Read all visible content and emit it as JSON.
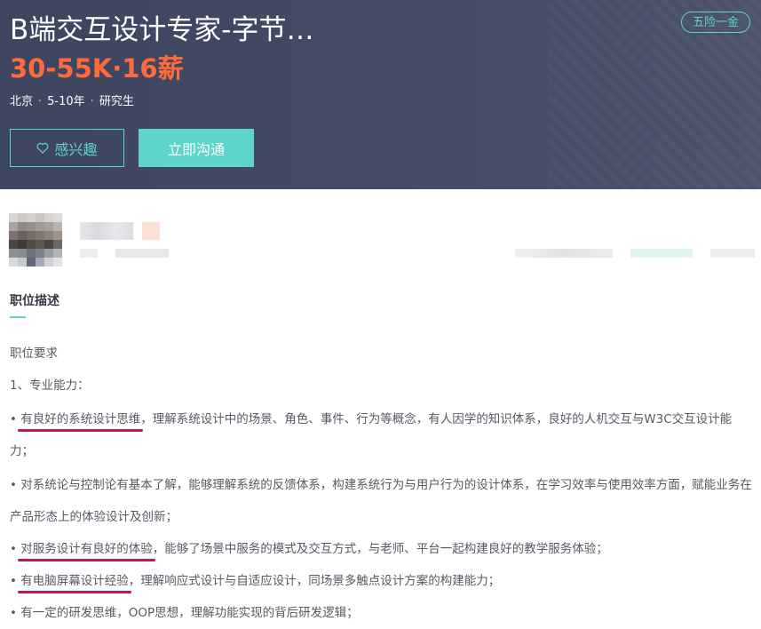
{
  "job": {
    "title": "B端交互设计专家-字节…",
    "salary": "30-55K·16薪",
    "benefit": "五险一金",
    "meta": [
      "北京",
      "5-10年",
      "研究生"
    ]
  },
  "actions": {
    "interest_label": "感兴趣",
    "chat_label": "立即沟通"
  },
  "description": {
    "section_title": "职位描述",
    "heading": "职位要求",
    "subheading": "1、专业能力：",
    "items": [
      {
        "bullet": "• ",
        "highlight": "有良好的系统设计思维",
        "rest": "，理解系统设计中的场景、角色、事件、行为等概念，有人因学的知识体系，良好的人机交互与W3C交互设计能力；"
      },
      {
        "bullet": "• ",
        "highlight": "",
        "rest": "对系统论与控制论有基本了解，能够理解系统的反馈体系，构建系统行为与用户行为的设计体系，在学习效率与使用效率方面，赋能业务在产品形态上的体验设计及创新；"
      },
      {
        "bullet": "• ",
        "highlight": "对服务设计有良好的体验",
        "rest": "，能够了场景中服务的模式及交互方式，与老师、平台一起构建良好的教学服务体验；"
      },
      {
        "bullet": "• ",
        "highlight": "有电脑屏幕设计经验",
        "rest": "，理解响应式设计与自适应设计，同场景多触点设计方案的构建能力；"
      },
      {
        "bullet": "• ",
        "highlight": "",
        "rest": "有一定的研发思维，OOP思想，理解功能实现的背后研发逻辑；"
      }
    ]
  },
  "colors": {
    "accent": "#5dd5c8",
    "salary": "#ff6a3d",
    "header_bg": "#434a63",
    "underline": "#c0174b"
  },
  "icons": {
    "interest": "heart-outline-icon"
  }
}
